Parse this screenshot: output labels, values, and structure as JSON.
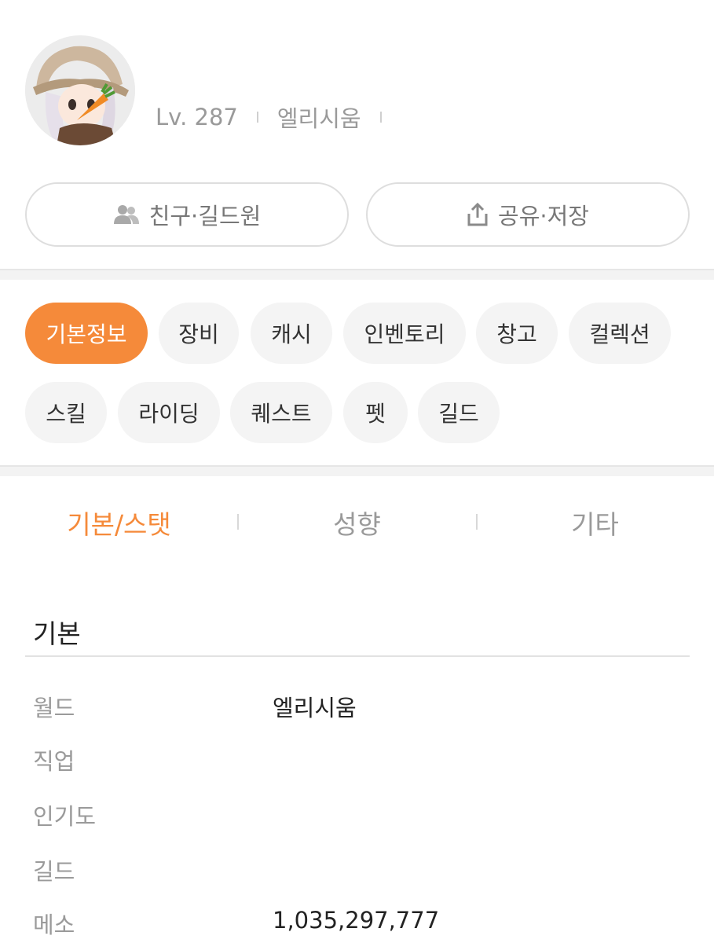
{
  "profile": {
    "character_name": "",
    "level": "Lv. 287",
    "world": "엘리시움"
  },
  "actions": {
    "friends_label": "친구·길드원",
    "share_label": "공유·저장"
  },
  "categories": [
    {
      "label": "기본정보",
      "active": true
    },
    {
      "label": "장비"
    },
    {
      "label": "캐시"
    },
    {
      "label": "인벤토리"
    },
    {
      "label": "창고"
    },
    {
      "label": "컬렉션"
    },
    {
      "label": "스킬"
    },
    {
      "label": "라이딩"
    },
    {
      "label": "퀘스트"
    },
    {
      "label": "펫"
    },
    {
      "label": "길드"
    }
  ],
  "subtabs": [
    {
      "label": "기본/스탯",
      "active": true
    },
    {
      "label": "성향"
    },
    {
      "label": "기타"
    }
  ],
  "basic": {
    "title": "기본",
    "rows": [
      {
        "key": "월드",
        "value": "엘리시움"
      },
      {
        "key": "직업",
        "value": ""
      },
      {
        "key": "인기도",
        "value": ""
      },
      {
        "key": "길드",
        "value": ""
      },
      {
        "key": "메소",
        "value": "1,035,297,777"
      }
    ]
  },
  "colors": {
    "accent": "#f58a3a",
    "chip_bg": "#f4f4f4",
    "muted_text": "#9a9a9a"
  }
}
